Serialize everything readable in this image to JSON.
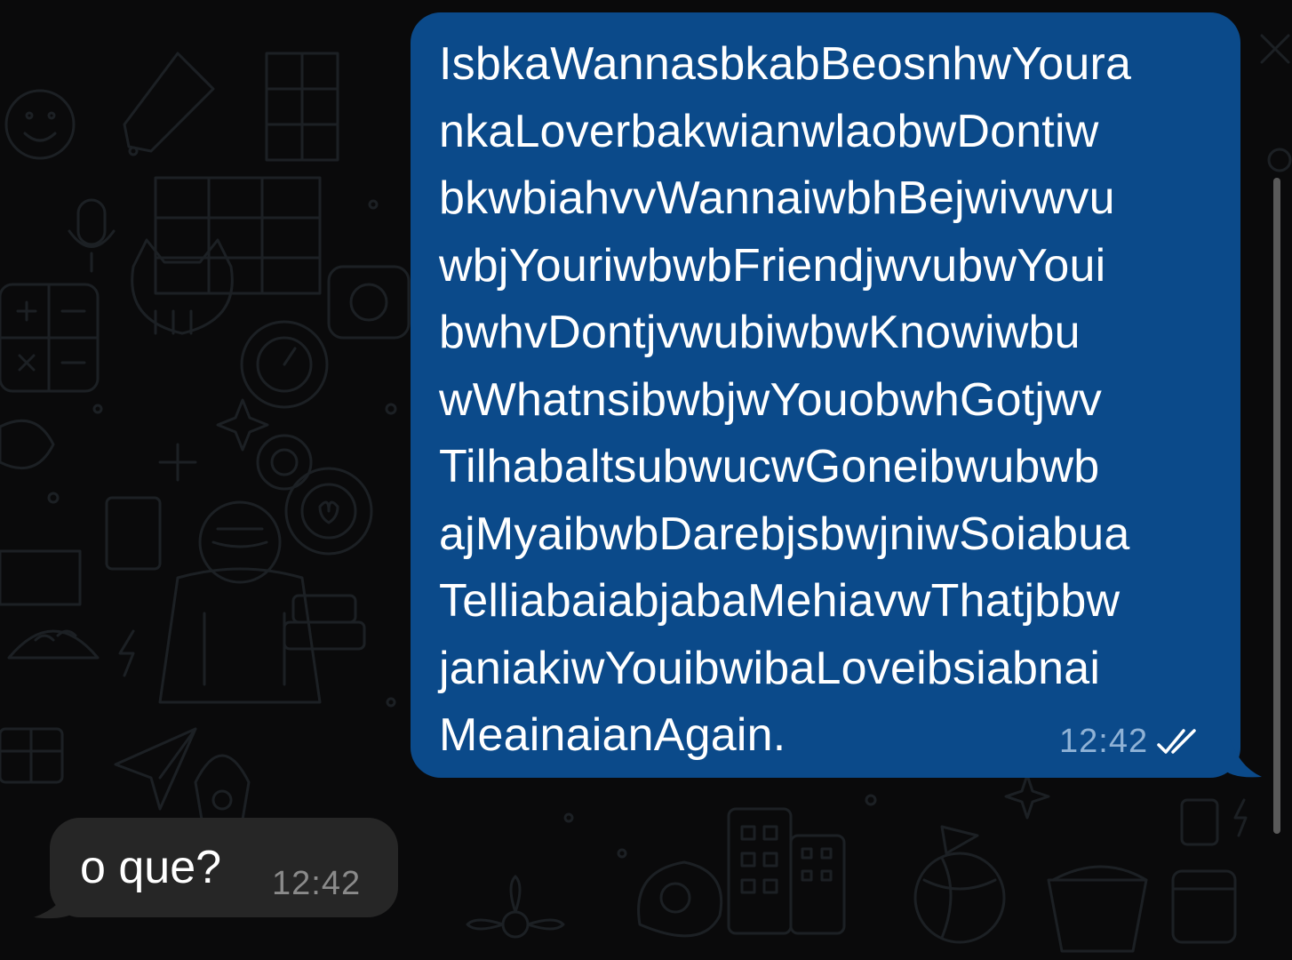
{
  "colors": {
    "background": "#0a0a0b",
    "outgoing_bubble": "#0b4a8a",
    "incoming_bubble": "#262626",
    "outgoing_time": "#8fb2d6",
    "incoming_time": "#8a8a8a",
    "text": "#ffffff"
  },
  "messages": [
    {
      "direction": "outgoing",
      "lines": [
        "IsbkaWannasbkabBeosnhwYoura",
        "nkaLoverbakwianwlaobwDontiw",
        "bkwbiahvvWannaiwbhBejwivwvu",
        "wbjYouriwbwbFriendjwvubwYoui",
        "bwhvDontjvwubiwbwKnowiwbu",
        "wWhatnsibwbjwYouobwhGotjwv",
        "TilhabaltsubwucwGoneibwubwb",
        "ajMyaibwbDarebjsbwjniwSoiabua",
        "TelliabaiabjabaMehiavwThatjbbw",
        "janiakiwYouibwibaLoveibsiabnai",
        "MeainaianAgain."
      ],
      "time": "12:42",
      "status_icon": "double-check-read-icon"
    },
    {
      "direction": "incoming",
      "text": "o que?",
      "time": "12:42"
    }
  ]
}
